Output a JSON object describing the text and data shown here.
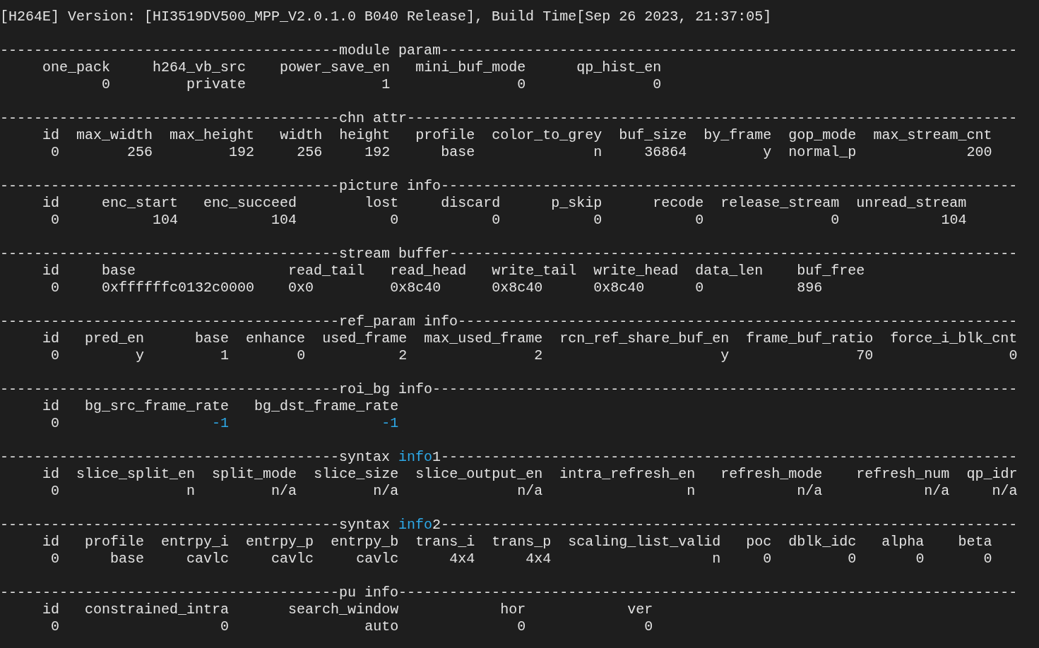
{
  "banner": "[H264E] Version: [HI3519DV500_MPP_V2.0.1.0 B040 Release], Build Time[Sep 26 2023, 21:37:05]",
  "sections": [
    {
      "rule": [
        {
          "text": "----------------------------------------module param--------------------------------------------------------------------",
          "highlighted": false
        }
      ],
      "columns": [
        {
          "text": "     one_pack     h264_vb_src    power_save_en   mini_buf_mode      qp_hist_en",
          "highlighted": false
        }
      ],
      "values": [
        {
          "text": "            0         private                1               0               0",
          "highlighted": false
        }
      ]
    },
    {
      "rule": [
        {
          "text": "----------------------------------------chn attr------------------------------------------------------------------------",
          "highlighted": false
        }
      ],
      "columns": [
        {
          "text": "     id  max_width  max_height   width  height   profile  color_to_grey  buf_size  by_frame  gop_mode  max_stream_cnt",
          "highlighted": false
        }
      ],
      "values": [
        {
          "text": "      0        256         192     256     192      base              n     36864         y  normal_p             200",
          "highlighted": false
        }
      ]
    },
    {
      "rule": [
        {
          "text": "----------------------------------------picture info--------------------------------------------------------------------",
          "highlighted": false
        }
      ],
      "columns": [
        {
          "text": "     id     enc_start   enc_succeed        lost     discard      p_skip      recode  release_stream  unread_stream",
          "highlighted": false
        }
      ],
      "values": [
        {
          "text": "      0           104           104           0           0           0           0               0            104",
          "highlighted": false
        }
      ]
    },
    {
      "rule": [
        {
          "text": "----------------------------------------stream buffer-------------------------------------------------------------------",
          "highlighted": false
        }
      ],
      "columns": [
        {
          "text": "     id     base                  read_tail   read_head   write_tail  write_head  data_len    buf_free",
          "highlighted": false
        }
      ],
      "values": [
        {
          "text": "      0     0xffffffc0132c0000    0x0         0x8c40      0x8c40      0x8c40      0           896",
          "highlighted": false
        }
      ]
    },
    {
      "rule": [
        {
          "text": "----------------------------------------ref_param info------------------------------------------------------------------",
          "highlighted": false
        }
      ],
      "columns": [
        {
          "text": "     id   pred_en      base  enhance  used_frame  max_used_frame  rcn_ref_share_buf_en  frame_buf_ratio  force_i_blk_cnt",
          "highlighted": false
        }
      ],
      "values": [
        {
          "text": "      0         y         1        0           2               2                     y               70                0",
          "highlighted": false
        }
      ]
    },
    {
      "rule": [
        {
          "text": "----------------------------------------roi_bg info---------------------------------------------------------------------",
          "highlighted": false
        }
      ],
      "columns": [
        {
          "text": "     id   bg_src_frame_rate   bg_dst_frame_rate",
          "highlighted": false
        }
      ],
      "values": [
        {
          "text": "      0                  ",
          "highlighted": false
        },
        {
          "text": "-1",
          "highlighted": true
        },
        {
          "text": "                  -1",
          "highlighted": true
        }
      ]
    },
    {
      "rule": [
        {
          "text": "----------------------------------------syntax ",
          "highlighted": false
        },
        {
          "text": "info",
          "highlighted": true
        },
        {
          "text": "1--------------------------------------------------------------------",
          "highlighted": false
        }
      ],
      "columns": [
        {
          "text": "     id  slice_split_en  split_mode  slice_size  slice_output_en  intra_refresh_en   refresh_mode    refresh_num  qp_idr",
          "highlighted": false
        }
      ],
      "values": [
        {
          "text": "      0               n         n/a         n/a              n/a                 n            n/a            n/a     n/a",
          "highlighted": false
        }
      ]
    },
    {
      "rule": [
        {
          "text": "----------------------------------------syntax ",
          "highlighted": false
        },
        {
          "text": "info",
          "highlighted": true
        },
        {
          "text": "2--------------------------------------------------------------------",
          "highlighted": false
        }
      ],
      "columns": [
        {
          "text": "     id   profile  entrpy_i  entrpy_p  entrpy_b  trans_i  trans_p  scaling_list_valid   poc  dblk_idc   alpha    beta",
          "highlighted": false
        }
      ],
      "values": [
        {
          "text": "      0      base     cavlc     cavlc     cavlc      4x4      4x4                   n     0         0       0       0",
          "highlighted": false
        }
      ]
    },
    {
      "rule": [
        {
          "text": "----------------------------------------pu info-------------------------------------------------------------------------",
          "highlighted": false
        }
      ],
      "columns": [
        {
          "text": "     id   constrained_intra       search_window            hor            ver",
          "highlighted": false
        }
      ],
      "values": [
        {
          "text": "      0                   0                auto              0              0",
          "highlighted": false
        }
      ]
    }
  ]
}
